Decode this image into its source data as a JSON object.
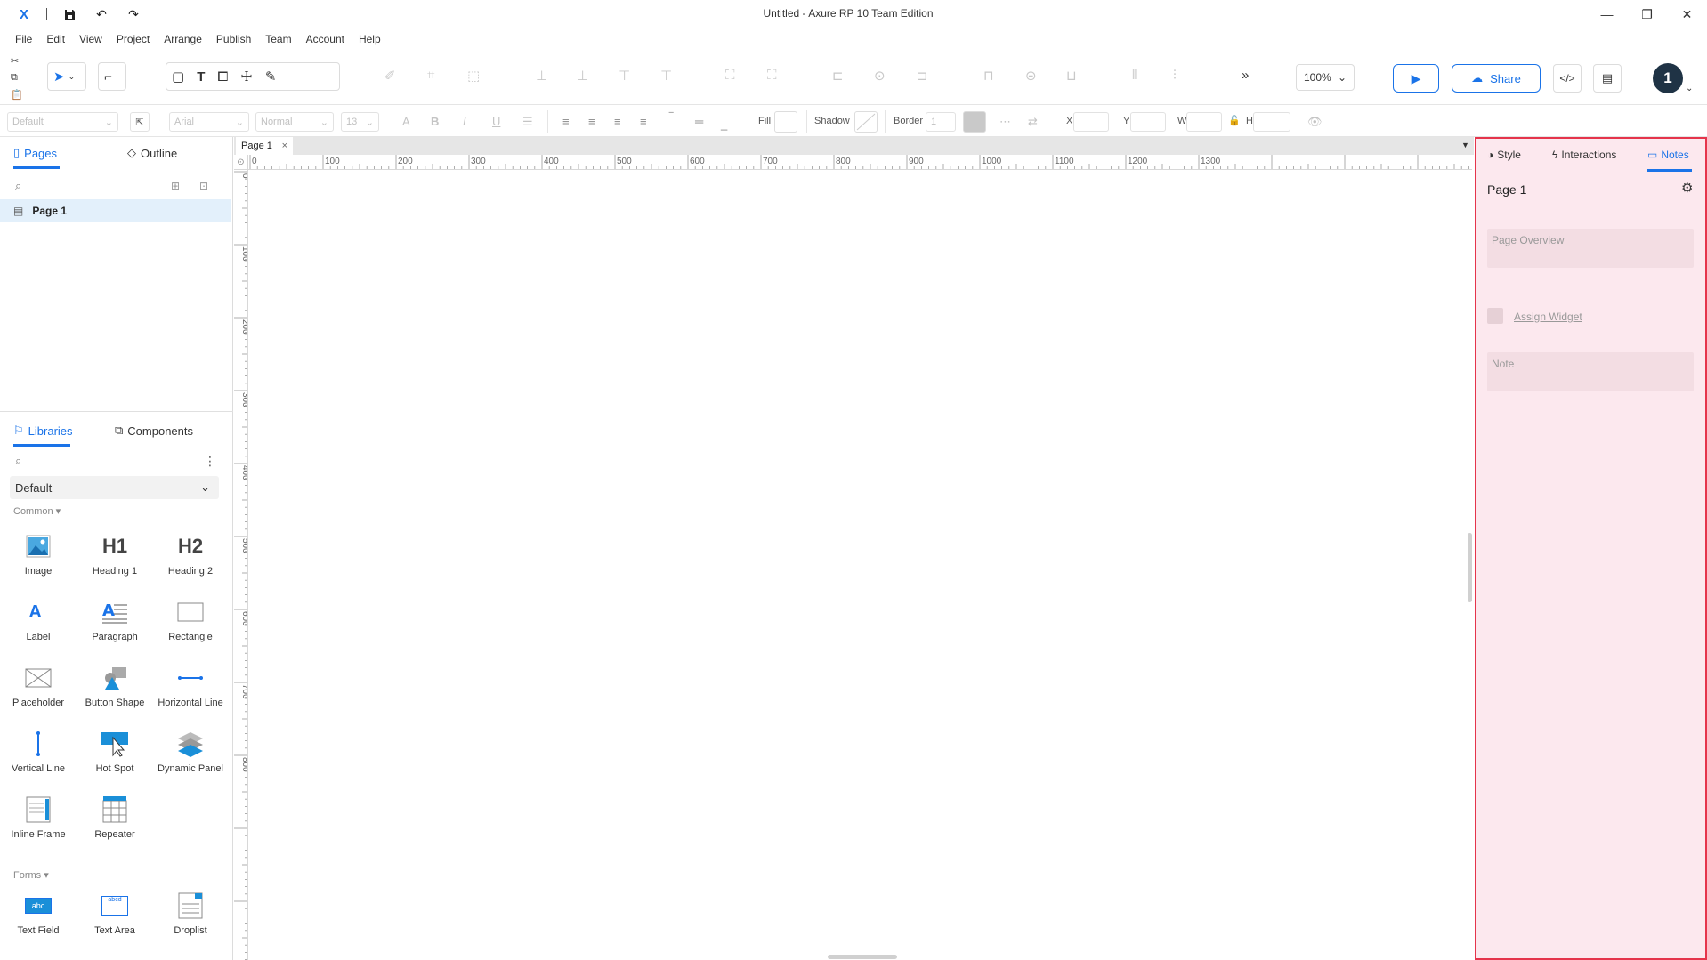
{
  "window": {
    "title": "Untitled - Axure RP 10 Team Edition",
    "app_logo": "X",
    "minimize": "—",
    "maximize": "❐",
    "close": "✕"
  },
  "menu": [
    "File",
    "Edit",
    "View",
    "Project",
    "Arrange",
    "Publish",
    "Team",
    "Account",
    "Help"
  ],
  "toolbar": {
    "zoom": "100%",
    "share_label": "Share",
    "avatar_initial": "1"
  },
  "stylebar": {
    "style_select": "Default",
    "font_select": "Arial",
    "weight_select": "Normal",
    "size_select": "13",
    "fill_label": "Fill",
    "shadow_label": "Shadow",
    "border_label": "Border",
    "border_value": "1",
    "x_label": "X",
    "y_label": "Y",
    "w_label": "W",
    "h_label": "H"
  },
  "left_panel": {
    "tabs": {
      "pages": "Pages",
      "outline": "Outline"
    },
    "pages": [
      {
        "label": "Page 1"
      }
    ],
    "lib_tabs": {
      "libraries": "Libraries",
      "components": "Components"
    },
    "library_select": "Default",
    "sections": {
      "common": "Common",
      "forms": "Forms"
    },
    "common_widgets": [
      {
        "label": "Image",
        "icon": "image-icon"
      },
      {
        "label": "Heading 1",
        "icon": "H1"
      },
      {
        "label": "Heading 2",
        "icon": "H2"
      },
      {
        "label": "Label",
        "icon": "label-icon"
      },
      {
        "label": "Paragraph",
        "icon": "paragraph-icon"
      },
      {
        "label": "Rectangle",
        "icon": "rectangle-icon"
      },
      {
        "label": "Placeholder",
        "icon": "placeholder-icon"
      },
      {
        "label": "Button Shape",
        "icon": "button-shape-icon"
      },
      {
        "label": "Horizontal Line",
        "icon": "horizontal-line-icon"
      },
      {
        "label": "Vertical Line",
        "icon": "vertical-line-icon"
      },
      {
        "label": "Hot Spot",
        "icon": "hot-spot-icon"
      },
      {
        "label": "Dynamic Panel",
        "icon": "dynamic-panel-icon"
      },
      {
        "label": "Inline Frame",
        "icon": "inline-frame-icon"
      },
      {
        "label": "Repeater",
        "icon": "repeater-icon"
      }
    ],
    "form_widgets": [
      {
        "label": "Text Field",
        "icon": "abc"
      },
      {
        "label": "Text Area",
        "icon": "abcd"
      },
      {
        "label": "Droplist",
        "icon": "droplist-icon"
      }
    ]
  },
  "canvas": {
    "page_tab": "Page 1",
    "ruler_h": [
      "0",
      "100",
      "200",
      "300",
      "400",
      "500",
      "600",
      "700",
      "800",
      "900",
      "1000",
      "1100",
      "1200",
      "1300"
    ],
    "ruler_v": [
      "0",
      "100",
      "200",
      "300",
      "400",
      "500",
      "600",
      "700",
      "800"
    ]
  },
  "right_panel": {
    "tabs": {
      "style": "Style",
      "interactions": "Interactions",
      "notes": "Notes"
    },
    "title": "Page 1",
    "page_overview_placeholder": "Page Overview",
    "assign_widget": "Assign Widget",
    "note_placeholder": "Note",
    "border_color": "#e5344b",
    "background": "#fce8ee"
  },
  "colors": {
    "accent": "#1a73e8"
  }
}
